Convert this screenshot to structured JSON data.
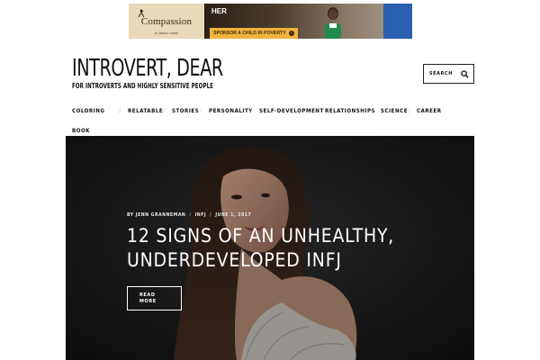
{
  "ad": {
    "brand": "Compassion",
    "tagline": "in Jesus' name",
    "headline": "HER",
    "cta": "SPONSOR A CHILD IN POVERTY",
    "colors": {
      "cta": "#f0b43c",
      "accent": "#2b5fb0"
    }
  },
  "header": {
    "site_title": "INTROVERT, DEAR",
    "site_tagline": "FOR INTROVERTS AND HIGHLY SENSITIVE PEOPLE",
    "search_label": "SEARCH",
    "search_icon": "search-icon"
  },
  "nav": {
    "items": [
      {
        "label": "COLORING BOOK"
      },
      {
        "label": "RELATABLE"
      },
      {
        "label": "STORIES"
      },
      {
        "label": "PERSONALITY"
      },
      {
        "label": "SELF-DEVELOPMENT"
      },
      {
        "label": "RELATIONSHIPS"
      },
      {
        "label": "SCIENCE"
      },
      {
        "label": "CAREER"
      }
    ]
  },
  "hero": {
    "author": "BY JENN GRANNEMAN",
    "category": "INFJ",
    "date": "JUNE 1, 2017",
    "headline": "12 SIGNS OF AN UNHEALTHY, UNDERDEVELOPED INFJ",
    "read_more_line1": "READ",
    "read_more_line2": "MORE"
  }
}
